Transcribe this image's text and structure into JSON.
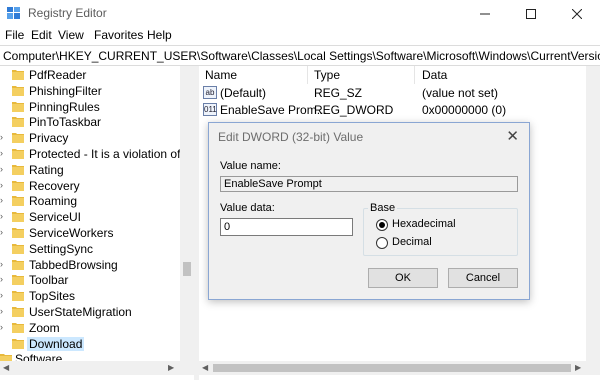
{
  "window": {
    "title": "Registry Editor"
  },
  "menu": [
    "File",
    "Edit",
    "View",
    "Favorites",
    "Help"
  ],
  "address": "Computer\\HKEY_CURRENT_USER\\Software\\Classes\\Local Settings\\Software\\Microsoft\\Windows\\CurrentVersion\\AppContainer",
  "tree": {
    "items": [
      {
        "label": "PdfReader",
        "expandable": false
      },
      {
        "label": "PhishingFilter",
        "expandable": false
      },
      {
        "label": "PinningRules",
        "expandable": false
      },
      {
        "label": "PinToTaskbar",
        "expandable": false
      },
      {
        "label": "Privacy",
        "expandable": true
      },
      {
        "label": "Protected - It is a violation of W",
        "expandable": true
      },
      {
        "label": "Rating",
        "expandable": true
      },
      {
        "label": "Recovery",
        "expandable": true
      },
      {
        "label": "Roaming",
        "expandable": true
      },
      {
        "label": "ServiceUI",
        "expandable": true
      },
      {
        "label": "ServiceWorkers",
        "expandable": true
      },
      {
        "label": "SettingSync",
        "expandable": false
      },
      {
        "label": "TabbedBrowsing",
        "expandable": true
      },
      {
        "label": "Toolbar",
        "expandable": true
      },
      {
        "label": "TopSites",
        "expandable": true
      },
      {
        "label": "UserStateMigration",
        "expandable": true
      },
      {
        "label": "Zoom",
        "expandable": true
      },
      {
        "label": "Download",
        "expandable": false,
        "selected": true
      }
    ],
    "root_item": "Software"
  },
  "list": {
    "columns": [
      "Name",
      "Type",
      "Data"
    ],
    "rows": [
      {
        "icon": "ab",
        "name": "(Default)",
        "type": "REG_SZ",
        "data": "(value not set)"
      },
      {
        "icon": "011",
        "name": "EnableSave Prom...",
        "type": "REG_DWORD",
        "data": "0x00000000 (0)"
      }
    ]
  },
  "dialog": {
    "title": "Edit DWORD (32-bit) Value",
    "value_name_label": "Value name:",
    "value_name": "EnableSave Prompt",
    "value_data_label": "Value data:",
    "value_data": "0",
    "base_label": "Base",
    "base_options": [
      "Hexadecimal",
      "Decimal"
    ],
    "base_selected": "Hexadecimal",
    "ok_label": "OK",
    "cancel_label": "Cancel"
  },
  "colors": {
    "selection": "#cce8ff",
    "folder": "#e8b93c",
    "dialog_border": "#8aa6d3"
  }
}
